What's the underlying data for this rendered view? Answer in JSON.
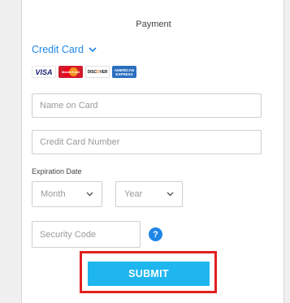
{
  "header": {
    "title": "Payment"
  },
  "payment_method": {
    "selected": "Credit Card",
    "icon": "chevron-down-icon"
  },
  "accepted_cards": {
    "visa": "VISA",
    "mastercard": "MasterCard",
    "discover_left": "DISC",
    "discover_o": "O",
    "discover_right": "VER",
    "amex_line1": "AMERICAN",
    "amex_line2": "EXPRESS"
  },
  "form": {
    "name_placeholder": "Name on Card",
    "number_placeholder": "Credit Card Number",
    "expiration_label": "Expiration Date",
    "month_value": "Month",
    "year_value": "Year",
    "security_placeholder": "Security Code",
    "help_symbol": "?",
    "submit_label": "SUBMIT"
  },
  "colors": {
    "accent": "#1f86e6",
    "submit": "#1fb6f0",
    "highlight": "#e0201f"
  }
}
